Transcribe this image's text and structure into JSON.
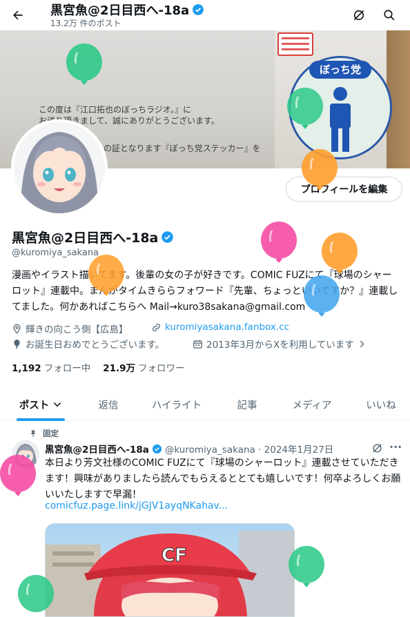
{
  "header": {
    "title": "黒宮魚@2日目西へ-18a",
    "post_count": "13.2万 件のポスト"
  },
  "banner": {
    "text_line1": "この度は『江口拓也のぼっちラジオ。』に",
    "text_line2": "お送り頂きまして、誠にありがとうございます。",
    "text_line3": "の証となります『ぼっち党ステッカー』を",
    "sticker_title": "ぼっち党"
  },
  "profile": {
    "edit_button": "プロフィールを編集",
    "display_name": "黒宮魚@2日目西へ-18a",
    "handle": "@kuromiya_sakana",
    "bio": "漫画やイラスト描いてます。後輩の女の子が好きです。COMIC FUZにて『球場のシャーロット』連載中。まんがタイムきららフォワード『先輩、ちょっといいですか？』連載してました。何かあればこちらへ Mail→kuro38sakana@gmail.com",
    "location": "輝きの向こう側【広島】",
    "website": "kuromiyasakana.fanbox.cc",
    "birthday": "お誕生日おめでとうございます。",
    "joined": "2013年3月からXを利用しています",
    "following_count": "1,192",
    "following_label": "フォロー中",
    "followers_count": "21.9万",
    "followers_label": "フォロワー"
  },
  "tabs": [
    "ポスト",
    "返信",
    "ハイライト",
    "記事",
    "メディア",
    "いいね"
  ],
  "tweet": {
    "pinned_label": "固定",
    "name": "黒宮魚@2日目西へ-18a",
    "handle_date": "@kuromiya_sakana · 2024年1月27日",
    "more": "···",
    "text": "本日より芳文社様のCOMIC FUZにて『球場のシャーロット』連載させていただきます！興味がありましたら読んでもらえるととても嬉しいです！何卒よろしくお願いいたしますで早漏！",
    "link": "comicfuz.page.link/jGJV1ayqNKahav..."
  },
  "colors": {
    "accent": "#1d9bf0",
    "balloon_green": "#2fc98a",
    "balloon_orange": "#ff9f2e",
    "balloon_pink": "#f550a6",
    "balloon_blue": "#45a7ee"
  },
  "icons": {
    "back": "arrow-left-icon",
    "grok": "grok-icon",
    "search": "search-icon",
    "verified": "verified-badge-icon",
    "location": "location-pin-icon",
    "link": "link-icon",
    "birthday": "balloon-icon",
    "calendar": "calendar-icon",
    "pin": "pin-icon"
  }
}
